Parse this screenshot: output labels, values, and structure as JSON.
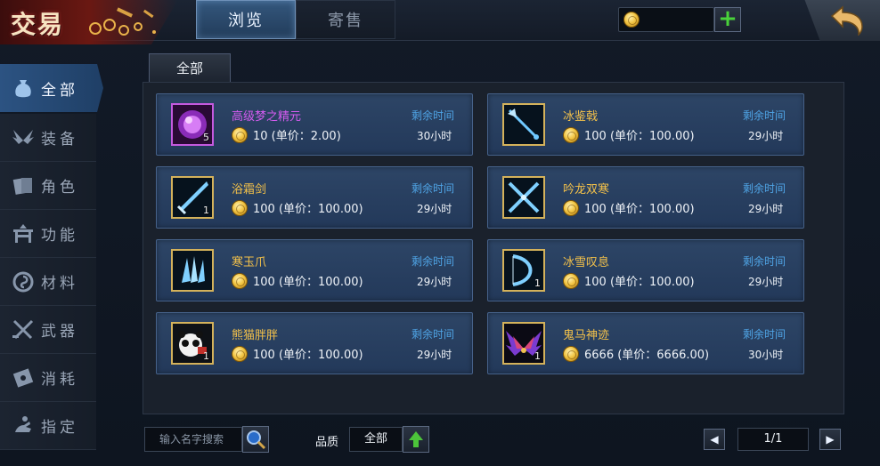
{
  "header": {
    "title": "交易",
    "tabs": [
      {
        "label": "浏览",
        "active": true
      },
      {
        "label": "寄售",
        "active": false
      }
    ],
    "coin_balance": "",
    "add_icon": "plus-icon",
    "back_icon": "back-arrow-icon"
  },
  "sidebar": {
    "items": [
      {
        "label": "全部",
        "icon": "money-bag-icon",
        "active": true
      },
      {
        "label": "装备",
        "icon": "wings-icon",
        "active": false
      },
      {
        "label": "角色",
        "icon": "cards-icon",
        "active": false
      },
      {
        "label": "功能",
        "icon": "bench-icon",
        "active": false
      },
      {
        "label": "材料",
        "icon": "swirl-icon",
        "active": false
      },
      {
        "label": "武器",
        "icon": "crossed-swords-icon",
        "active": false
      },
      {
        "label": "消耗",
        "icon": "scroll-icon",
        "active": false
      },
      {
        "label": "指定",
        "icon": "hand-icon",
        "active": false
      }
    ]
  },
  "category_tab": "全部",
  "listings": [
    {
      "name": "高级梦之精元",
      "qty": "5",
      "price": "10 (单价：2.00)",
      "time_label": "剩余时间",
      "time": "30小时",
      "rarity": "purple",
      "icon": "purple-essence-icon"
    },
    {
      "name": "冰鉴戟",
      "qty": "",
      "price": "100 (单价：100.00)",
      "time_label": "剩余时间",
      "time": "29小时",
      "rarity": "gold",
      "icon": "ice-halberd-icon"
    },
    {
      "name": "浴霜剑",
      "qty": "1",
      "price": "100 (单价：100.00)",
      "time_label": "剩余时间",
      "time": "29小时",
      "rarity": "gold",
      "icon": "frost-sword-icon"
    },
    {
      "name": "吟龙双寒",
      "qty": "",
      "price": "100 (单价：100.00)",
      "time_label": "剩余时间",
      "time": "29小时",
      "rarity": "gold",
      "icon": "twin-blades-icon"
    },
    {
      "name": "寒玉爪",
      "qty": "",
      "price": "100 (单价：100.00)",
      "time_label": "剩余时间",
      "time": "29小时",
      "rarity": "gold",
      "icon": "jade-claw-icon"
    },
    {
      "name": "冰雪叹息",
      "qty": "1",
      "price": "100 (单价：100.00)",
      "time_label": "剩余时间",
      "time": "29小时",
      "rarity": "gold",
      "icon": "ice-bow-icon"
    },
    {
      "name": "熊猫胖胖",
      "qty": "1",
      "price": "100 (单价：100.00)",
      "time_label": "剩余时间",
      "time": "29小时",
      "rarity": "gold",
      "icon": "panda-icon"
    },
    {
      "name": "鬼马神迹",
      "qty": "1",
      "price": "6666 (单价：6666.00)",
      "time_label": "剩余时间",
      "time": "30小时",
      "rarity": "gold",
      "icon": "demon-wings-icon"
    }
  ],
  "footer": {
    "search_placeholder": "输入名字搜索",
    "quality_label": "品质",
    "quality_value": "全部",
    "page": "1/1",
    "prev_icon": "left-arrow-icon",
    "next_icon": "right-arrow-icon"
  },
  "colors": {
    "accent_blue": "#2c5382",
    "name_gold": "#f3c14a",
    "name_purple": "#d55cf0",
    "time_label_blue": "#4fa4e5",
    "add_green": "#49d23a"
  }
}
